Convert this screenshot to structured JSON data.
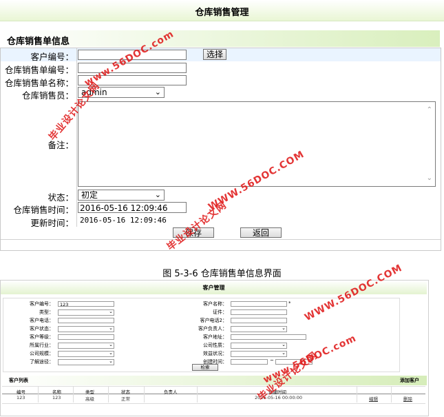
{
  "top_form": {
    "window_title": "仓库销售管理",
    "section_title": "仓库销售单信息",
    "fields": {
      "customer_no_label": "客户编号：",
      "customer_no_value": "",
      "select_button": "选择",
      "order_no_label": "仓库销售单编号：",
      "order_no_value": "",
      "order_name_label": "仓库销售单名称：",
      "order_name_value": "",
      "salesperson_label": "仓库销售员：",
      "salesperson_value": "admin",
      "remark_label": "备注：",
      "status_label": "状态：",
      "status_value": "初定",
      "sale_time_label": "仓库销售时间：",
      "sale_time_value": "2016-05-16 12:09:46",
      "update_time_label": "更新时间：",
      "update_time_value": "2016-05-16 12:09:46"
    },
    "save_button": "保存",
    "back_button": "返回"
  },
  "caption": "图 5-3-6 仓库销售单信息界面",
  "watermark": {
    "line1": "毕业设计论文网",
    "line2": "www.56DOC.com",
    "line3": "WWW.56DOC.COM",
    "color": "#e02020"
  },
  "customer_mgmt": {
    "title": "客户管理",
    "left_labels": [
      "客户编号：",
      "类型：",
      "客户电话：",
      "客户状态：",
      "客户等级：",
      "所属行业：",
      "公司规模：",
      "了解途径："
    ],
    "customer_no_value": "123",
    "right_labels": [
      "客户名称：",
      "证件：",
      "客户电话2：",
      "客户负责人：",
      "客户地址：",
      "公司性质：",
      "效益状况：",
      "创建时间："
    ],
    "required_mark": "*",
    "date_sep": "~",
    "search_button": "检索",
    "list_title": "客户列表",
    "add_link": "添加客户",
    "columns": [
      "编号",
      "名称",
      "类型",
      "状态",
      "负责人",
      "创建时间"
    ],
    "rows": [
      {
        "no": "123",
        "name": "123",
        "type": "高级",
        "status": "正常",
        "owner": "",
        "created": "2016-05-16 00:00:00",
        "edit": "编辑",
        "delete": "删除"
      }
    ]
  }
}
